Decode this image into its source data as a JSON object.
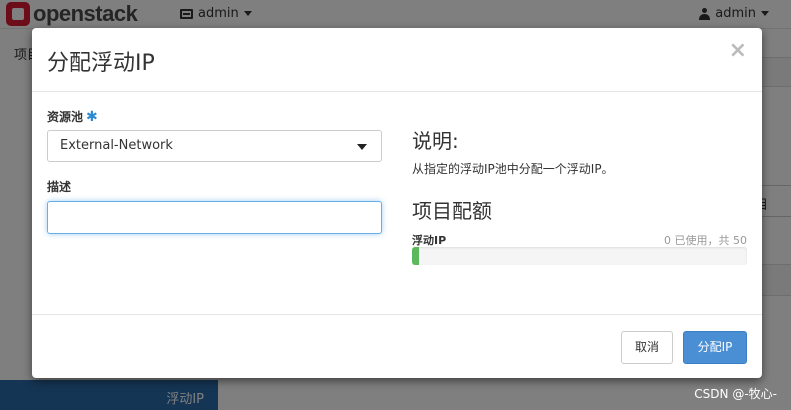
{
  "topbar": {
    "logo_text": "openstack",
    "project_label": "admin",
    "user_label": "admin"
  },
  "background": {
    "breadcrumb": "项目",
    "right_button_fragment": "目",
    "sidebar_active_item": "浮动IP",
    "watermark": "CSDN @-牧心-"
  },
  "modal": {
    "title": "分配浮动IP",
    "close_symbol": "×",
    "pool": {
      "label": "资源池",
      "required_mark": "✱",
      "selected": "External-Network"
    },
    "description": {
      "label": "描述",
      "value": ""
    },
    "help": {
      "heading": "说明:",
      "text": "从指定的浮动IP池中分配一个浮动IP。"
    },
    "quota": {
      "heading": "项目配额",
      "name": "浮动IP",
      "usage_text": "0 已使用，共 50",
      "used": 0,
      "total": 50
    },
    "buttons": {
      "cancel": "取消",
      "submit": "分配IP"
    }
  },
  "colors": {
    "primary": "#4a8fd4",
    "progress": "#5cb85c",
    "sidebar_active": "#2a6aa9",
    "brand_red": "#da1a32"
  }
}
